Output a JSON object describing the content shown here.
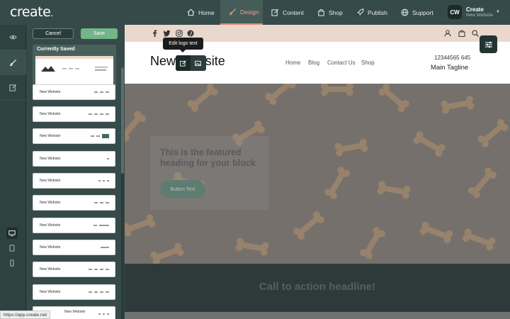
{
  "app": {
    "logo": "create",
    "logo_dot": "."
  },
  "nav": [
    {
      "label": "Home",
      "icon": "home-icon"
    },
    {
      "label": "Design",
      "icon": "brush-icon",
      "active": true
    },
    {
      "label": "Content",
      "icon": "edit-icon"
    },
    {
      "label": "Shop",
      "icon": "bag-icon"
    },
    {
      "label": "Publish",
      "icon": "rocket-icon"
    },
    {
      "label": "Support",
      "icon": "globe-icon"
    }
  ],
  "account": {
    "initials": "CW",
    "title": "Create",
    "subtitle": "New Website"
  },
  "panel": {
    "cancel_label": "Cancel",
    "save_label": "Save",
    "currently_saved_label": "Currently Saved",
    "templates": [
      {
        "name": "New Website"
      },
      {
        "name": "New Website"
      },
      {
        "name": "New Website"
      },
      {
        "name": "New Website"
      },
      {
        "name": "New Website"
      },
      {
        "name": "New Website"
      },
      {
        "name": "New Website"
      },
      {
        "name": "New Website"
      },
      {
        "name": "New Website"
      },
      {
        "name": "New Website"
      },
      {
        "name": "New Website"
      }
    ]
  },
  "preview": {
    "site_title": "New Website",
    "nav_links": [
      "Home",
      "Blog",
      "Contact Us",
      "Shop"
    ],
    "phone": "12344565 645",
    "tagline": "Main Tagline",
    "feature_heading": "This is the featured heading for your block",
    "feature_button": "Button Text",
    "cta_headline": "Call to action headline!"
  },
  "tooltip": "Edit logo text",
  "status_url": "https://app.create.net",
  "colors": {
    "accent": "#e88a73",
    "save": "#72b586",
    "panel": "#364b49"
  }
}
